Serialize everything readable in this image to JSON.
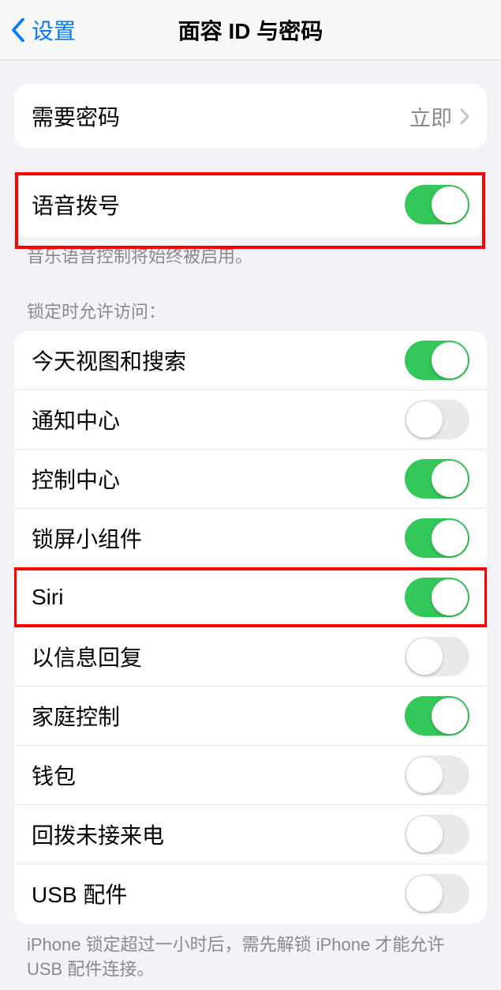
{
  "navbar": {
    "back_label": "设置",
    "title": "面容 ID 与密码"
  },
  "require_passcode": {
    "label": "需要密码",
    "value": "立即"
  },
  "voice_dial": {
    "label": "语音拨号",
    "on": true,
    "footer": "音乐语音控制将始终被启用。"
  },
  "allow_access_header": "锁定时允许访问：",
  "lock_items": [
    {
      "label": "今天视图和搜索",
      "on": true
    },
    {
      "label": "通知中心",
      "on": false
    },
    {
      "label": "控制中心",
      "on": true
    },
    {
      "label": "锁屏小组件",
      "on": true
    },
    {
      "label": "Siri",
      "on": true
    },
    {
      "label": "以信息回复",
      "on": false
    },
    {
      "label": "家庭控制",
      "on": true
    },
    {
      "label": "钱包",
      "on": false
    },
    {
      "label": "回拨未接来电",
      "on": false
    },
    {
      "label": "USB 配件",
      "on": false
    }
  ],
  "usb_footer": "iPhone 锁定超过一小时后，需先解锁 iPhone 才能允许 USB 配件连接。"
}
